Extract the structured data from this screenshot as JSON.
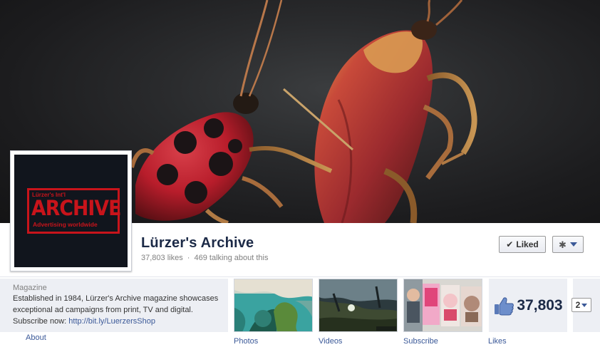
{
  "page": {
    "name": "Lürzer's Archive",
    "likes_text": "37,803 likes",
    "separator": "·",
    "talking_text": "469 talking about this"
  },
  "actions": {
    "liked_label": "Liked",
    "check_icon": "check-icon",
    "settings_icon": "gear-icon",
    "dropdown_icon": "chevron-down-icon"
  },
  "profile_logo": {
    "small": "Lürzer's Int'l",
    "big": "ARCHIVE",
    "tagline": "Advertising worldwide",
    "color": "#c8141b"
  },
  "about": {
    "category": "Magazine",
    "description": "Established in 1984, Lürzer's Archive magazine showcases exceptional ad campaigns from print, TV and digital.",
    "subscribe_prefix": "Subscribe now: ",
    "subscribe_link": "http://bit.ly/LuerzersShop",
    "link_label": "About"
  },
  "apps": [
    {
      "label": "Photos"
    },
    {
      "label": "Videos"
    },
    {
      "label": "Subscribe"
    },
    {
      "label": "Likes"
    }
  ],
  "likes_tile": {
    "count": "37,803",
    "icon": "thumbs-up-icon"
  },
  "more_apps": {
    "count": "2"
  },
  "colors": {
    "link": "#3b5998",
    "name": "#1c2a47",
    "panel": "#edeff4"
  }
}
